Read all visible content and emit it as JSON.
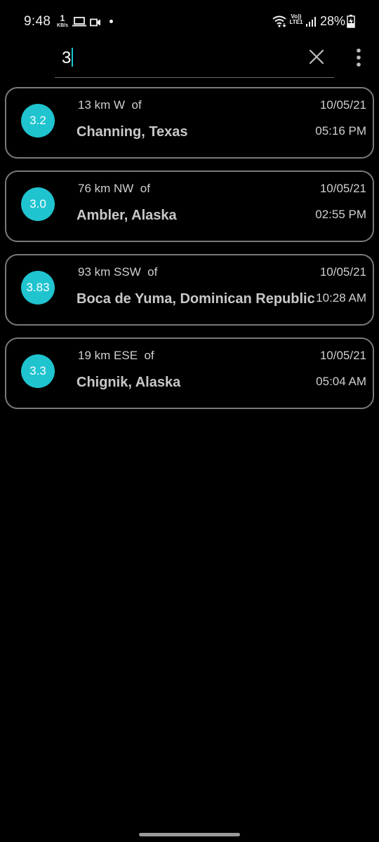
{
  "status_bar": {
    "time": "9:48",
    "net_speed_value": "1",
    "net_speed_unit": "KB/s",
    "volte_line1": "Vo))",
    "volte_line2": "LTE1",
    "battery_percent": "28%",
    "icons": [
      "laptop-icon",
      "video-camera-icon",
      "notification-dot-icon",
      "wifi-icon",
      "volte-lte-icon",
      "signal-icon",
      "battery-charging-icon"
    ]
  },
  "search": {
    "value": "3",
    "clear_icon": "close-icon",
    "menu_icon": "more-vert-icon"
  },
  "colors": {
    "background": "#000000",
    "accent": "#1fc4cf",
    "card_border": "#7a7a7a"
  },
  "quakes": [
    {
      "magnitude": "3.2",
      "offset": "13 km W  of",
      "place": "Channing, Texas",
      "date": "10/05/21",
      "time": "05:16 PM"
    },
    {
      "magnitude": "3.0",
      "offset": "76 km NW  of",
      "place": "Ambler, Alaska",
      "date": "10/05/21",
      "time": "02:55 PM"
    },
    {
      "magnitude": "3.83",
      "offset": "93 km SSW  of",
      "place": "Boca de Yuma, Dominican Republic",
      "date": "10/05/21",
      "time": "10:28 AM"
    },
    {
      "magnitude": "3.3",
      "offset": "19 km ESE  of",
      "place": "Chignik, Alaska",
      "date": "10/05/21",
      "time": "05:04 AM"
    }
  ]
}
